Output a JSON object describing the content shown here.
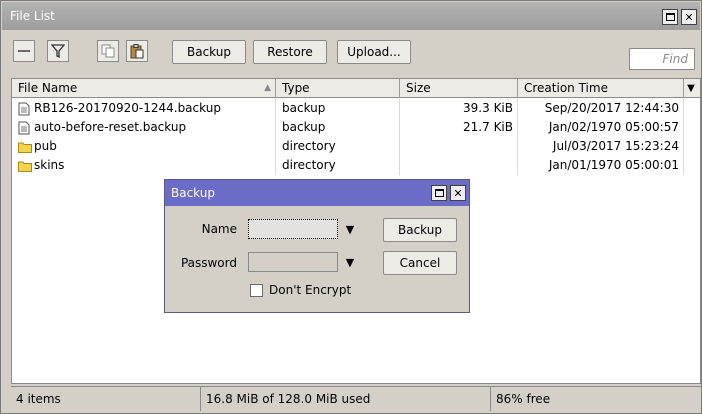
{
  "window": {
    "title": "File List"
  },
  "toolbar": {
    "backup_label": "Backup",
    "restore_label": "Restore",
    "upload_label": "Upload...",
    "find_placeholder": "Find"
  },
  "table": {
    "columns": [
      "File Name",
      "Type",
      "Size",
      "Creation Time"
    ],
    "rows": [
      {
        "name": "RB126-20170920-1244.backup",
        "icon": "file-icon",
        "type": "backup",
        "size": "39.3 KiB",
        "created": "Sep/20/2017 12:44:30"
      },
      {
        "name": "auto-before-reset.backup",
        "icon": "file-icon",
        "type": "backup",
        "size": "21.7 KiB",
        "created": "Jan/02/1970 05:00:57"
      },
      {
        "name": "pub",
        "icon": "folder-icon",
        "type": "directory",
        "size": "",
        "created": "Jul/03/2017 15:23:24"
      },
      {
        "name": "skins",
        "icon": "folder-icon",
        "type": "directory",
        "size": "",
        "created": "Jan/01/1970 05:00:01"
      }
    ]
  },
  "status": {
    "count": "4 items",
    "used": "16.8 MiB of 128.0 MiB used",
    "free": "86% free"
  },
  "dialog": {
    "title": "Backup",
    "name_label": "Name",
    "password_label": "Password",
    "dont_encrypt_label": "Don't Encrypt",
    "backup_button": "Backup",
    "cancel_button": "Cancel"
  },
  "colors": {
    "dialog_titlebar": "#6b6bc8",
    "window_titlebar": "#a8a8a8",
    "folder": "#f5d34a"
  }
}
